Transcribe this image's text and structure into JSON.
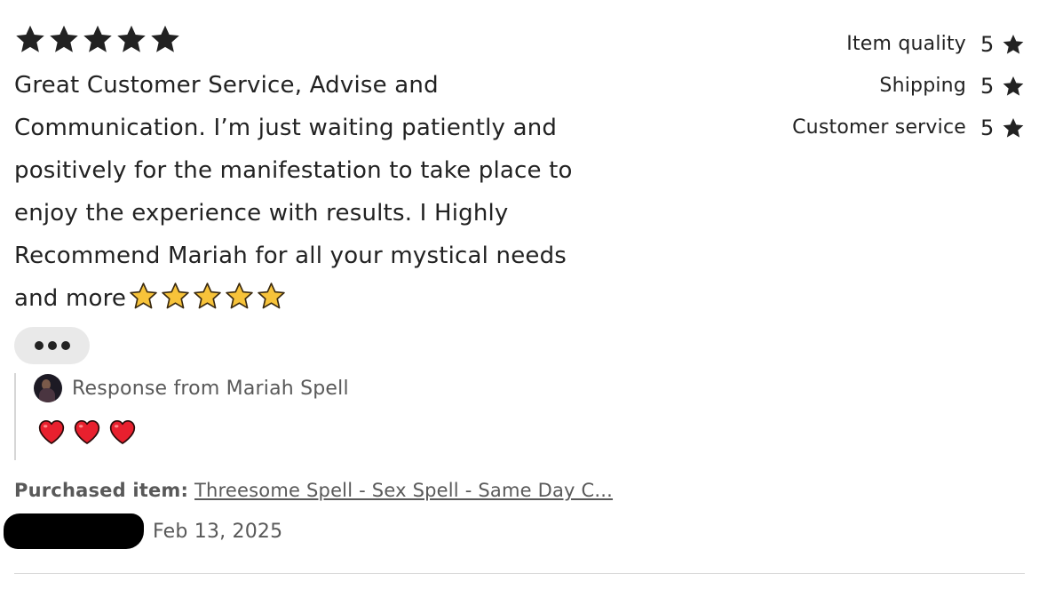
{
  "review": {
    "rating_stars": 5,
    "text": "Great Customer Service, Advise and Communication. I’m just waiting patiently and positively for the manifestation to take place to enjoy the experience with results. I Highly Recommend Mariah for all your mystical needs and more",
    "emoji_stars": 5,
    "more_icon": "ellipsis-icon",
    "response": {
      "title": "Response from Mariah Spell",
      "emoji_hearts": 3
    },
    "purchased_label": "Purchased item:",
    "purchased_item": "Threesome Spell - Sex Spell - Same Day C...",
    "reviewer_name": "[redacted]",
    "date": "Feb 13, 2025"
  },
  "ratings": [
    {
      "label": "Item quality",
      "value": "5"
    },
    {
      "label": "Shipping",
      "value": "5"
    },
    {
      "label": "Customer service",
      "value": "5"
    }
  ],
  "colors": {
    "text": "#222222",
    "muted_text": "#595959",
    "star": "#222222",
    "emoji_star": "#f7c33a",
    "emoji_heart": "#e8202e",
    "pill_bg": "#e9e9e9",
    "divider": "#d8d8d8"
  }
}
